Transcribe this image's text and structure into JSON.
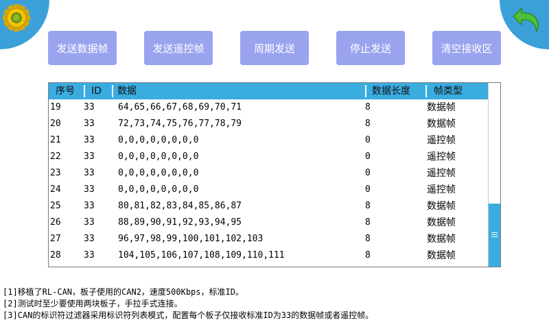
{
  "toolbar": {
    "buttons": [
      {
        "label": "发送数据帧"
      },
      {
        "label": "发送遥控帧"
      },
      {
        "label": "周期发送"
      },
      {
        "label": "停止发送"
      },
      {
        "label": "清空接收区"
      }
    ]
  },
  "table": {
    "headers": {
      "seq": "序号",
      "id": "ID",
      "data": "数据",
      "length": "数据长度",
      "type": "帧类型"
    },
    "rows": [
      {
        "seq": "19",
        "id": "33",
        "data": "64,65,66,67,68,69,70,71",
        "length": "8",
        "type": "数据帧"
      },
      {
        "seq": "20",
        "id": "33",
        "data": "72,73,74,75,76,77,78,79",
        "length": "8",
        "type": "数据帧"
      },
      {
        "seq": "21",
        "id": "33",
        "data": "0,0,0,0,0,0,0,0",
        "length": "0",
        "type": "遥控帧"
      },
      {
        "seq": "22",
        "id": "33",
        "data": "0,0,0,0,0,0,0,0",
        "length": "0",
        "type": "遥控帧"
      },
      {
        "seq": "23",
        "id": "33",
        "data": "0,0,0,0,0,0,0,0",
        "length": "0",
        "type": "遥控帧"
      },
      {
        "seq": "24",
        "id": "33",
        "data": "0,0,0,0,0,0,0,0",
        "length": "0",
        "type": "遥控帧"
      },
      {
        "seq": "25",
        "id": "33",
        "data": "80,81,82,83,84,85,86,87",
        "length": "8",
        "type": "数据帧"
      },
      {
        "seq": "26",
        "id": "33",
        "data": "88,89,90,91,92,93,94,95",
        "length": "8",
        "type": "数据帧"
      },
      {
        "seq": "27",
        "id": "33",
        "data": "96,97,98,99,100,101,102,103",
        "length": "8",
        "type": "数据帧"
      },
      {
        "seq": "28",
        "id": "33",
        "data": "104,105,106,107,108,109,110,111",
        "length": "8",
        "type": "数据帧"
      }
    ]
  },
  "notes": [
    "[1]移植了RL-CAN，板子使用的CAN2，速度500Kbps，标准ID。",
    "[2]测试时至少要使用两块板子，手拉手式连接。",
    "[3]CAN的标识符过滤器采用标识符列表模式，配置每个板子仅接收标准ID为33的数据帧或者遥控帧。"
  ],
  "icons": {
    "settings": "gear-icon",
    "back": "back-arrow-icon"
  },
  "colors": {
    "accent": "#3ba0d8",
    "button": "#9aa3ee",
    "header": "#3aace0",
    "gear": "#f2c500",
    "arrow": "#4fbf3a"
  }
}
